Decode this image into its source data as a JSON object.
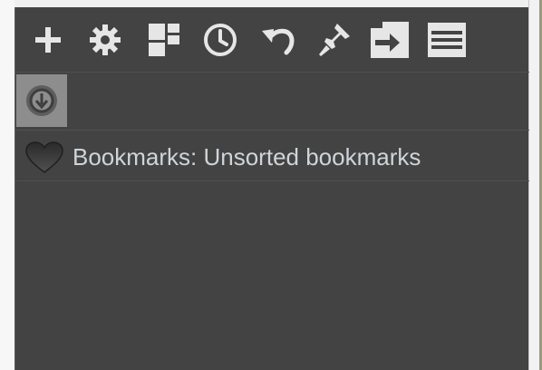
{
  "toolbar": {
    "icons": [
      {
        "name": "plus-icon",
        "label": ""
      },
      {
        "name": "gear-icon",
        "label": ""
      },
      {
        "name": "speed-dial-icon",
        "label": ""
      },
      {
        "name": "clock-icon",
        "label": ""
      },
      {
        "name": "undo-icon",
        "label": ""
      },
      {
        "name": "pin-icon",
        "label": ""
      },
      {
        "name": "import-icon",
        "label": ""
      },
      {
        "name": "menu-icon",
        "label": ""
      }
    ]
  },
  "download": {
    "icon": "download-icon"
  },
  "bookmark": {
    "icon": "heart-icon",
    "label": "Bookmarks: Unsorted bookmarks"
  },
  "colors": {
    "panel_bg": "#434343",
    "icon": "#e6e6e6",
    "text": "#cfd4d9",
    "active_button": "#8d8d8d"
  }
}
